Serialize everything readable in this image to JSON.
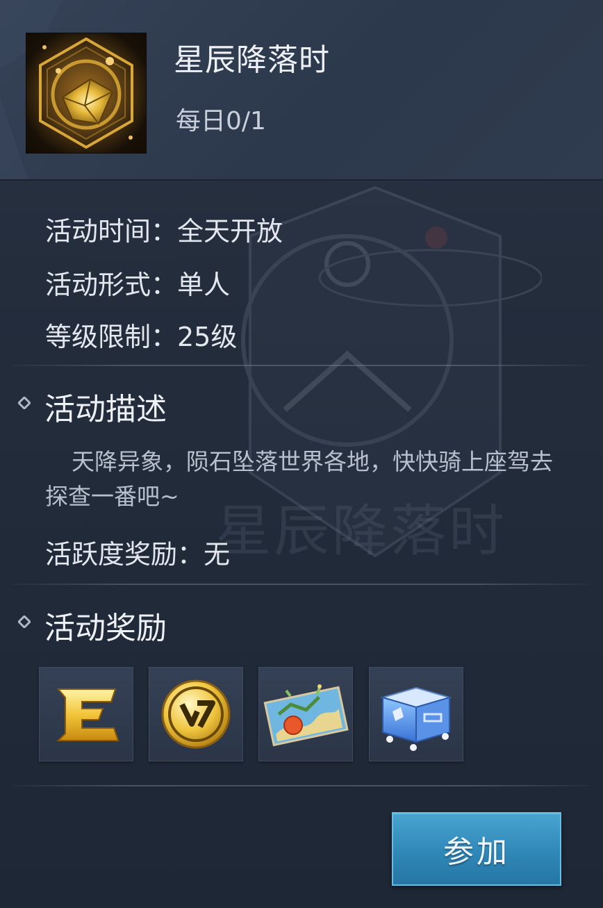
{
  "header": {
    "title": "星辰降落时",
    "daily_progress": "每日0/1",
    "icon": "golden-crystal-hexagon-icon"
  },
  "watermark": {
    "text": "星辰降落时"
  },
  "info": {
    "time": "活动时间：全天开放",
    "format": "活动形式：单人",
    "level": "等级限制：25级"
  },
  "description_section": {
    "title": "活动描述",
    "text": "天降异象，陨石坠落世界各地，快快骑上座驾去探查一番吧~",
    "activity_reward": "活跃度奖励：无"
  },
  "rewards_section": {
    "title": "活动奖励",
    "items": [
      {
        "icon": "gold-e-exp-icon"
      },
      {
        "icon": "gold-coin-icon"
      },
      {
        "icon": "treasure-map-icon"
      },
      {
        "icon": "blue-chest-icon"
      }
    ]
  },
  "actions": {
    "join_label": "参加"
  },
  "colors": {
    "accent_button": "#2f88b8",
    "gold": "#e6b83a",
    "text_primary": "#eef1f6"
  }
}
